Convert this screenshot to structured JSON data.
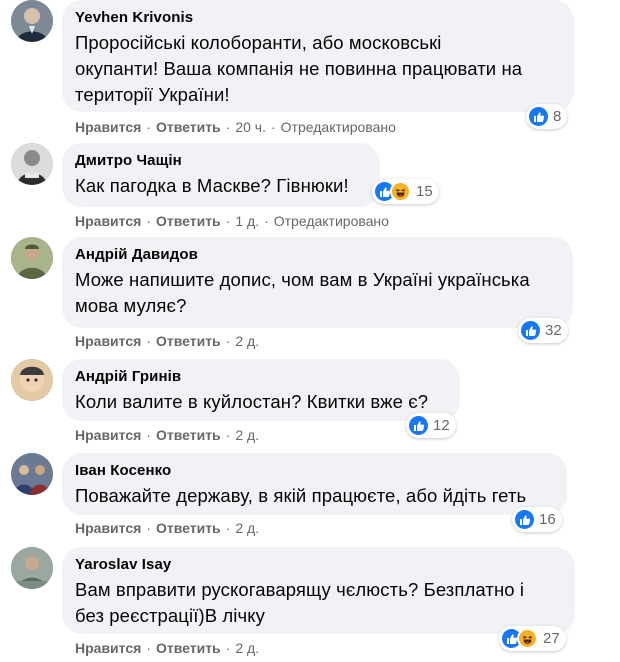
{
  "comments": [
    {
      "author": "Yevhen Krivonis",
      "lines": [
        "Проросійські колоборанти, або московські",
        "окупанти! Ваша компанія не повинна працювати на",
        "території України!"
      ],
      "reactions": [
        "like"
      ],
      "reaction_count": "8",
      "like_label": "Нравится",
      "reply_label": "Ответить",
      "time": "20 ч.",
      "edited": "Отредактировано"
    },
    {
      "author": "Дмитро Чащін",
      "lines": [
        "Как пагодка в Маскве? Гівнюки!"
      ],
      "reactions": [
        "like",
        "haha"
      ],
      "reaction_count": "15",
      "like_label": "Нравится",
      "reply_label": "Ответить",
      "time": "1 д.",
      "edited": "Отредактировано"
    },
    {
      "author": "Андрій Давидов",
      "lines": [
        "Може напишите допис, чом вам в Україні українська",
        "мова муляє?"
      ],
      "reactions": [
        "like"
      ],
      "reaction_count": "32",
      "like_label": "Нравится",
      "reply_label": "Ответить",
      "time": "2 д.",
      "edited": ""
    },
    {
      "author": "Андрій Гринів",
      "lines": [
        "Коли валите в куйлостан? Квитки вже є?"
      ],
      "reactions": [
        "like"
      ],
      "reaction_count": "12",
      "like_label": "Нравится",
      "reply_label": "Ответить",
      "time": "2 д.",
      "edited": ""
    },
    {
      "author": "Іван Косенко",
      "lines": [
        "Поважайте державу, в якій працюєте, або йдіть геть"
      ],
      "reactions": [
        "like"
      ],
      "reaction_count": "16",
      "like_label": "Нравится",
      "reply_label": "Ответить",
      "time": "2 д.",
      "edited": ""
    },
    {
      "author": "Yaroslav Isay",
      "lines": [
        "Вам вправити рускогаварящу чєлюсть? Безплатно і",
        "без реєстрації)В лічку"
      ],
      "reactions": [
        "like",
        "haha"
      ],
      "reaction_count": "27",
      "like_label": "Нравится",
      "reply_label": "Ответить",
      "time": "2 д.",
      "edited": ""
    }
  ],
  "colors": {
    "bubble": "#f0f2f5",
    "meta": "#65676b",
    "like": "#1877f2",
    "haha": "#f7b125"
  },
  "icons": {
    "like": "thumbs-up-icon",
    "haha": "laughing-face-icon"
  }
}
